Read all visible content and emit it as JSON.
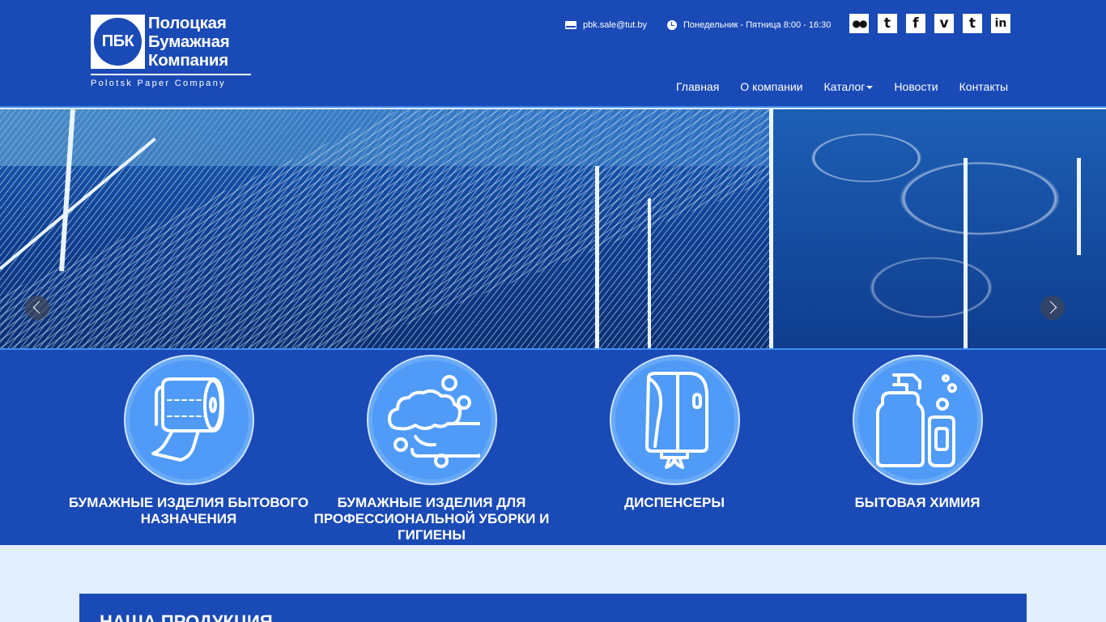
{
  "logo": {
    "badge": "ПБК",
    "lines": [
      "Полоцкая",
      "Бумажная",
      "Компания"
    ],
    "sub": "Polotsk Paper Company"
  },
  "contacts": {
    "email": "pbk.sale@tut.by",
    "hours": "Понедельник - Пятница 8:00 - 16:30"
  },
  "socials": [
    {
      "name": "flickr-icon",
      "glyph": "●●"
    },
    {
      "name": "twitter-icon",
      "glyph": "t"
    },
    {
      "name": "facebook-icon",
      "glyph": "f"
    },
    {
      "name": "vimeo-icon",
      "glyph": "v"
    },
    {
      "name": "tumblr-icon",
      "glyph": "t"
    },
    {
      "name": "linkedin-icon",
      "glyph": "in"
    }
  ],
  "nav": {
    "home": "Главная",
    "about": "О компании",
    "catalog": "Каталог",
    "news": "Новости",
    "contacts": "Контакты"
  },
  "categories": [
    {
      "title": "Бумажные изделия бытового назначения",
      "icon": "toilet-paper-icon"
    },
    {
      "title": "Бумажные изделия для профессиональной уборки и гигиены",
      "icon": "soap-foam-icon"
    },
    {
      "title": "Диспенсеры",
      "icon": "dispenser-icon"
    },
    {
      "title": "Бытовая химия",
      "icon": "detergent-bottle-icon"
    }
  ],
  "products": {
    "title": "НАША ПРОДУКЦИЯ"
  },
  "colors": {
    "primary": "#1a4ab6",
    "accent": "#3d8ef0",
    "circle": "#4f9bf7",
    "background": "#e3eefc"
  }
}
